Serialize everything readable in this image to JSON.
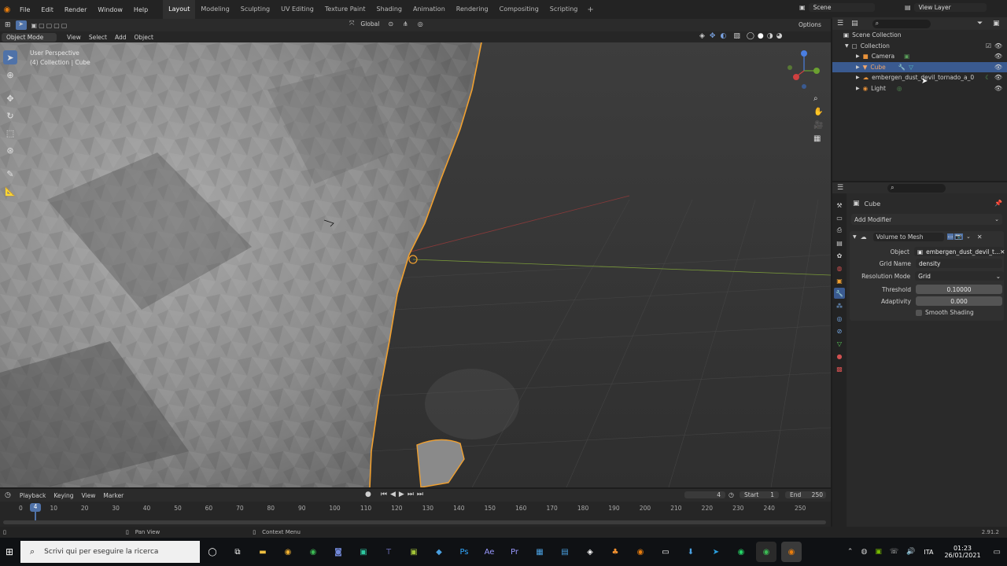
{
  "menubar": {
    "items": [
      "File",
      "Edit",
      "Render",
      "Window",
      "Help"
    ]
  },
  "workspaces": [
    "Layout",
    "Modeling",
    "Sculpting",
    "UV Editing",
    "Texture Paint",
    "Shading",
    "Animation",
    "Rendering",
    "Compositing",
    "Scripting"
  ],
  "scene": {
    "name": "Scene",
    "view_layer": "View Layer"
  },
  "viewport_header": {
    "mode": "Object Mode",
    "menus": [
      "View",
      "Select",
      "Add",
      "Object"
    ],
    "transform": "Global",
    "options": "Options"
  },
  "viewport_overlay": {
    "perspective": "User Perspective",
    "collection": "(4) Collection | Cube"
  },
  "outliner": {
    "root": "Scene Collection",
    "collection": "Collection",
    "items": [
      {
        "name": "Camera",
        "selected": false
      },
      {
        "name": "Cube",
        "selected": true
      },
      {
        "name": "embergen_dust_devil_tornado_a_0",
        "selected": false
      },
      {
        "name": "Light",
        "selected": false
      }
    ]
  },
  "properties": {
    "object_name": "Cube",
    "add_modifier": "Add Modifier",
    "modifier_name": "Volume to Mesh",
    "fields": {
      "object_label": "Object",
      "object_value": "embergen_dust_devil_t...",
      "grid_label": "Grid Name",
      "grid_value": "density",
      "resolution_label": "Resolution Mode",
      "resolution_value": "Grid",
      "threshold_label": "Threshold",
      "threshold_value": "0.10000",
      "adaptivity_label": "Adaptivity",
      "adaptivity_value": "0.000",
      "smooth_label": "Smooth Shading"
    }
  },
  "timeline": {
    "menus": [
      "Playback",
      "Keying",
      "View",
      "Marker"
    ],
    "current_frame": "4",
    "start_label": "Start",
    "start": "1",
    "end_label": "End",
    "end": "250",
    "ticks": [
      "0",
      "10",
      "20",
      "30",
      "40",
      "50",
      "60",
      "70",
      "80",
      "90",
      "100",
      "110",
      "120",
      "130",
      "140",
      "150",
      "160",
      "170",
      "180",
      "190",
      "200",
      "210",
      "220",
      "230",
      "240",
      "250"
    ]
  },
  "statusbar": {
    "pan": "Pan View",
    "context": "Context Menu",
    "version": "2.91.2"
  },
  "taskbar": {
    "search_placeholder": "Scrivi qui per eseguire la ricerca",
    "lang": "ITA",
    "time": "01:23",
    "date": "26/01/2021"
  },
  "colors": {
    "accent": "#4f72a8",
    "selection_orange": "#f0a030",
    "panel": "#2a2a2a"
  }
}
